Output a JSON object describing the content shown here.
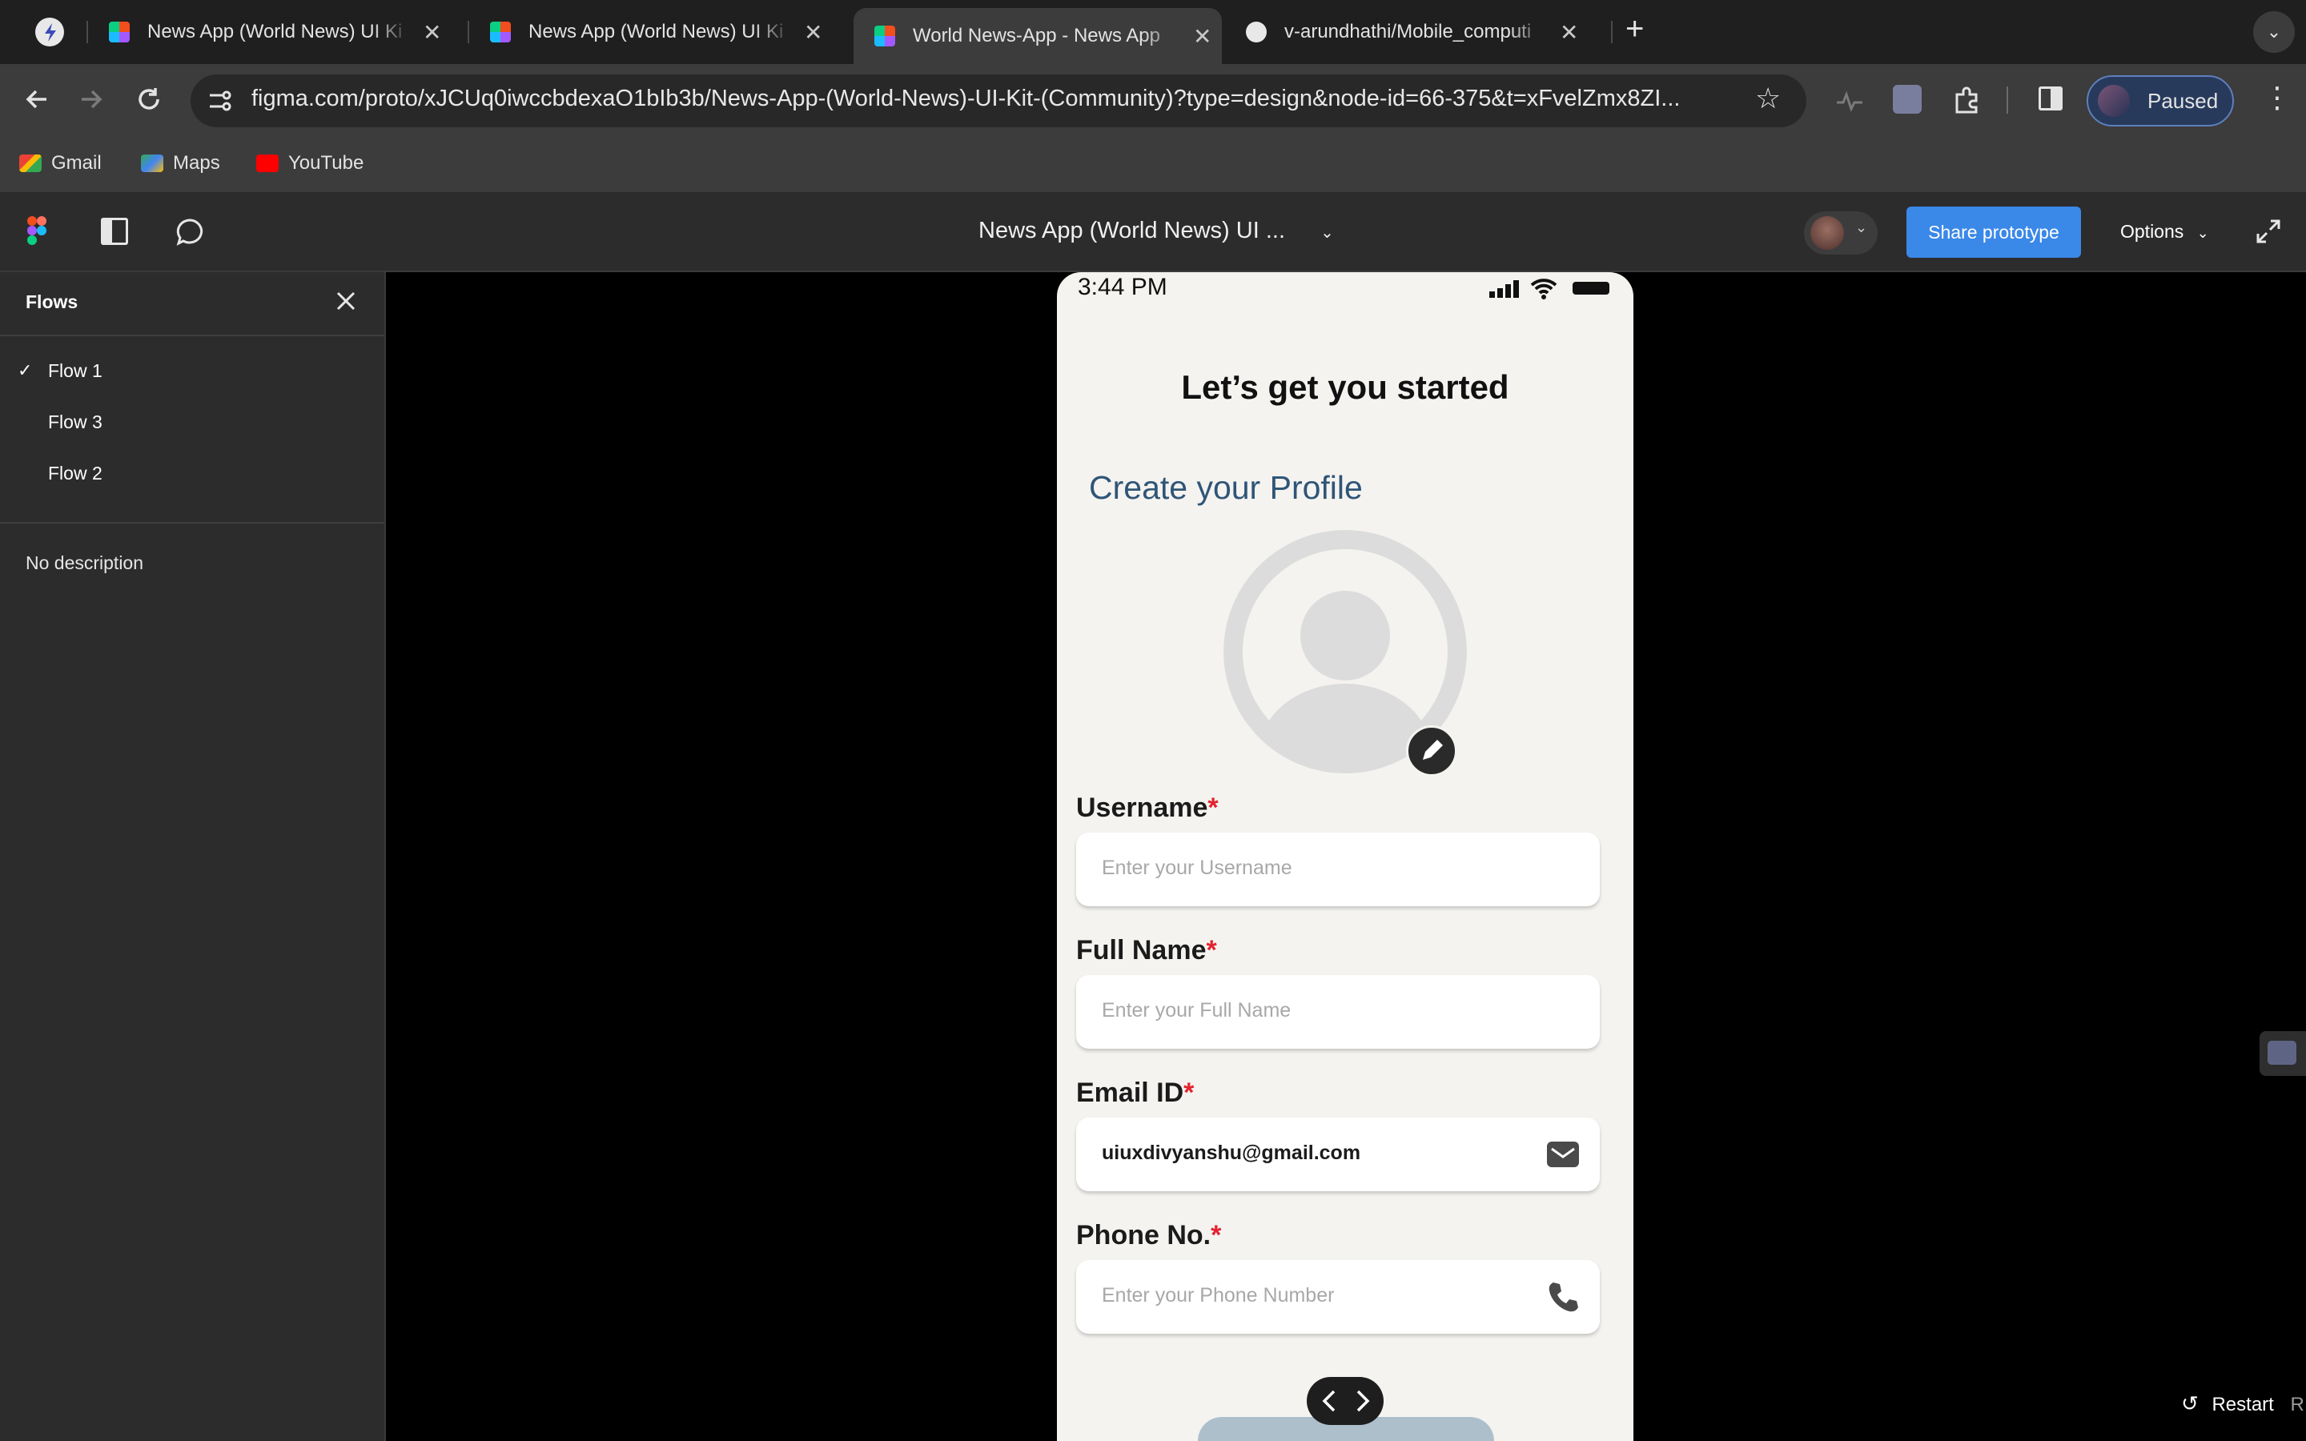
{
  "browser": {
    "tabs": [
      {
        "title": "News App (World News) UI Ki",
        "active": false
      },
      {
        "title": "News App (World News) UI Ki",
        "active": false
      },
      {
        "title": "World News-App - News App",
        "active": true
      },
      {
        "title": "v-arundhathi/Mobile_computi",
        "active": false
      }
    ],
    "url": "figma.com/proto/xJCUq0iwccbdexaO1bIb3b/News-App-(World-News)-UI-Kit-(Community)?type=design&node-id=66-375&t=xFvelZmx8ZI...",
    "bookmarks": [
      "Gmail",
      "Maps",
      "YouTube"
    ],
    "profile_status": "Paused"
  },
  "figma": {
    "file_title": "News App (World News) UI ...",
    "share_label": "Share prototype",
    "options_label": "Options",
    "restart_label": "Restart",
    "restart_shortcut": "R"
  },
  "sidebar": {
    "title": "Flows",
    "flows": [
      {
        "label": "Flow 1",
        "selected": true
      },
      {
        "label": "Flow 3",
        "selected": false
      },
      {
        "label": "Flow 2",
        "selected": false
      }
    ],
    "description": "No description"
  },
  "phone": {
    "time": "3:44 PM",
    "heading": "Let’s get you started",
    "subheading": "Create your Profile",
    "fields": [
      {
        "label": "Username",
        "placeholder": "Enter your Username",
        "value": "",
        "icon": null
      },
      {
        "label": "Full Name",
        "placeholder": "Enter your Full Name",
        "value": "",
        "icon": null
      },
      {
        "label": "Email ID",
        "placeholder": "",
        "value": "uiuxdivyanshu@gmail.com",
        "icon": "mail-icon"
      },
      {
        "label": "Phone No.",
        "placeholder": "Enter your Phone Number",
        "value": "",
        "icon": "phone-icon"
      }
    ],
    "required_mark": "*",
    "colors": {
      "subheading": "#2f5577",
      "required": "#e4222e",
      "button_partial": "#aebfcc"
    }
  }
}
